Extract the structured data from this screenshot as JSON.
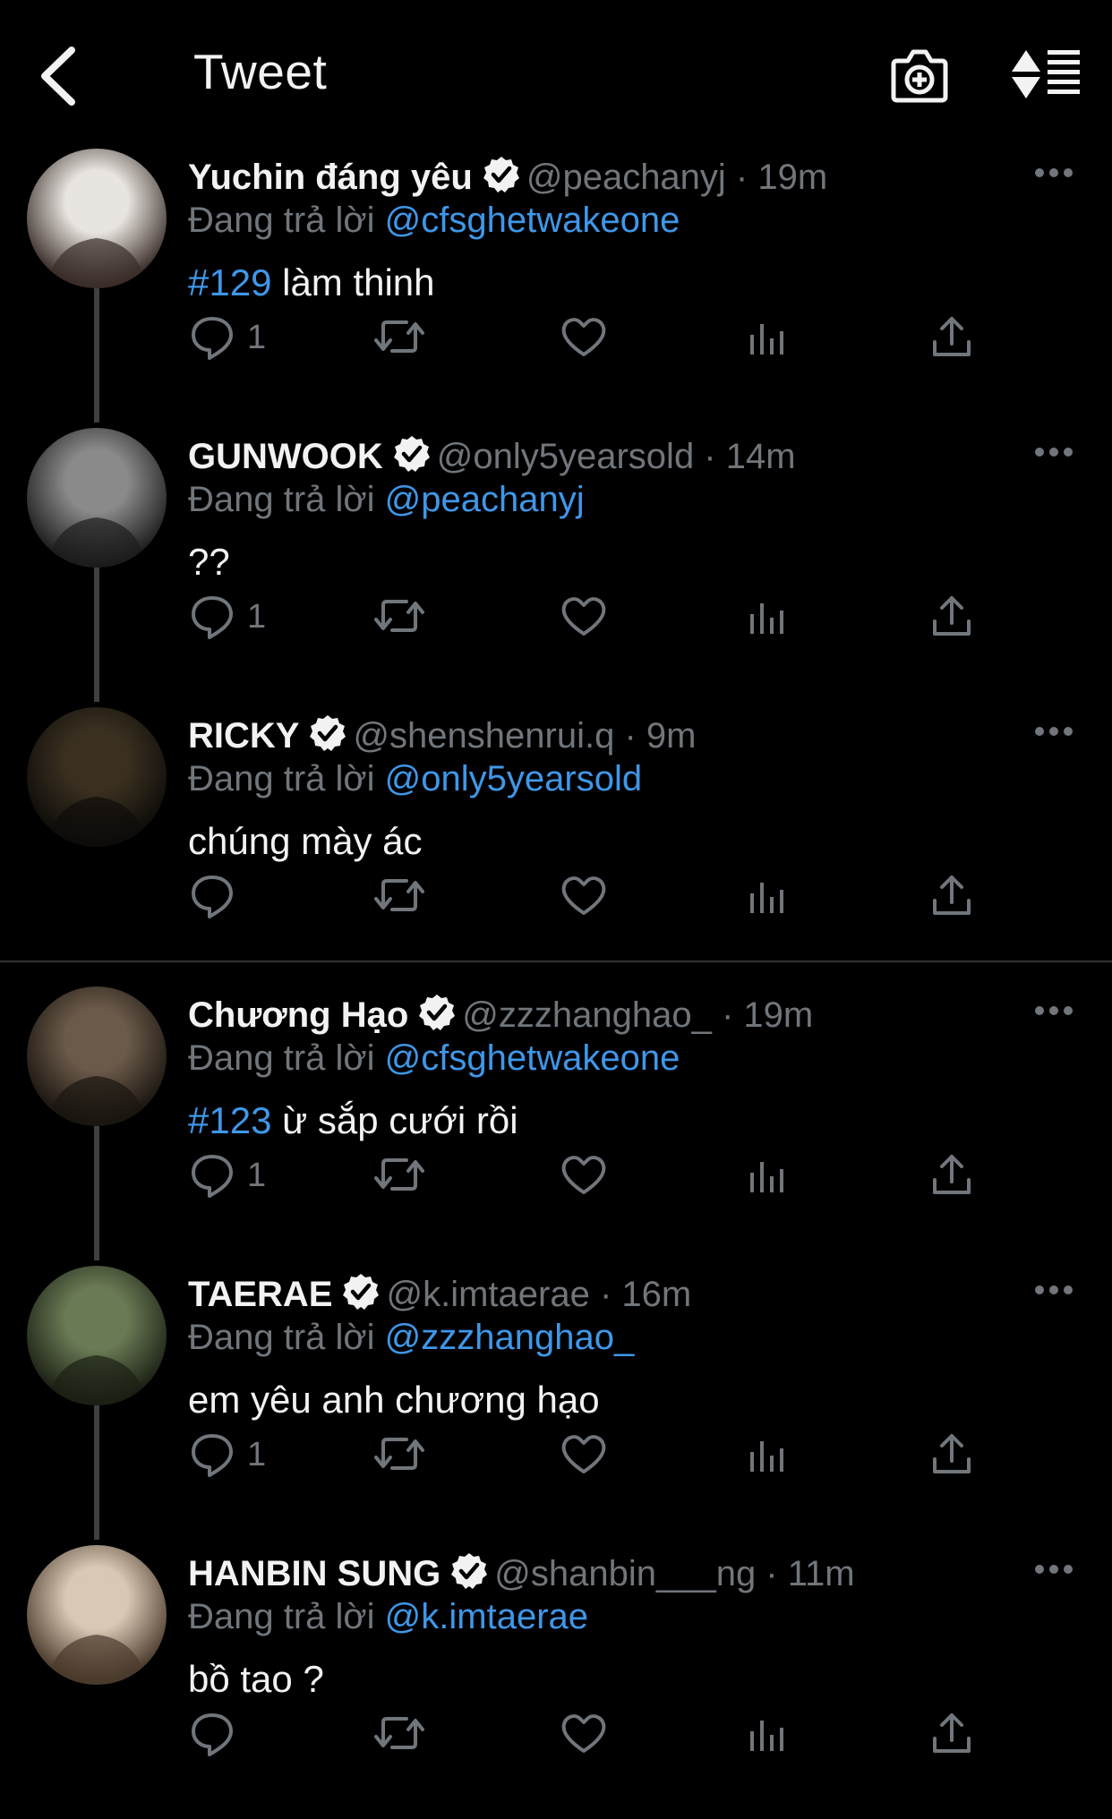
{
  "header": {
    "title": "Tweet",
    "back_icon": "chevron-left-icon",
    "camera_icon": "camera-plus-icon",
    "sort_icon": "sort-list-icon"
  },
  "colors": {
    "background": "#000000",
    "text": "#f2f2f2",
    "muted": "#70767b",
    "link": "#3f97e8",
    "thread_line": "#3e4144"
  },
  "reply_prefix": "Đang trả lời",
  "tweets": [
    {
      "name": "Yuchin đáng yêu",
      "handle": "@peachanyj",
      "time": "19m",
      "replying_to": "@cfsghetwakeone",
      "hashtag": "#129",
      "text": " làm thinh",
      "replies": "1"
    },
    {
      "name": "GUNWOOK",
      "handle": "@only5yearsold",
      "time": "14m",
      "replying_to": "@peachanyj",
      "hashtag": "",
      "text": "??",
      "replies": "1"
    },
    {
      "name": "RICKY",
      "handle": "@shenshenrui.q",
      "time": "9m",
      "replying_to": "@only5yearsold",
      "hashtag": "",
      "text": "chúng mày ác",
      "replies": ""
    },
    {
      "name": "Chương Hạo",
      "handle": "@zzzhanghao_",
      "time": "19m",
      "replying_to": "@cfsghetwakeone",
      "hashtag": "#123",
      "text": " ừ sắp cưới rồi",
      "replies": "1"
    },
    {
      "name": "TAERAE",
      "handle": "@k.imtaerae",
      "time": "16m",
      "replying_to": "@zzzhanghao_",
      "hashtag": "",
      "text": "em yêu anh chương hạo",
      "replies": "1"
    },
    {
      "name": "HANBIN SUNG",
      "handle": "@shanbin___ng",
      "time": "11m",
      "replying_to": "@k.imtaerae",
      "hashtag": "",
      "text": "bồ tao ?",
      "replies": ""
    }
  ]
}
